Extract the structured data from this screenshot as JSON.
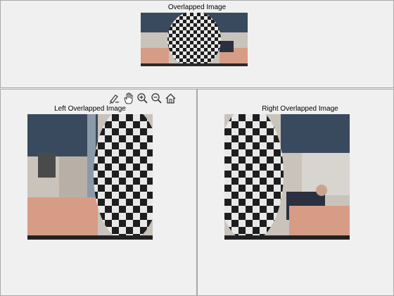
{
  "top": {
    "title": "Overlapped Image"
  },
  "left": {
    "title": "Left Overlapped Image"
  },
  "right": {
    "title": "Right Overlapped Image"
  },
  "toolbar": {
    "tools": [
      {
        "icon": "brush-icon"
      },
      {
        "icon": "pan-hand-icon"
      },
      {
        "icon": "zoom-in-icon"
      },
      {
        "icon": "zoom-out-icon"
      },
      {
        "icon": "home-icon"
      }
    ]
  },
  "colors": {
    "panel_bg": "#f0f0f0",
    "panel_border": "#a8a8a8",
    "checker_dark": "#1e1e1e",
    "checker_light": "#e8e8e8",
    "wall": "#c9c3bc",
    "ceiling": "#3a4a5e",
    "skin": "#d79c86"
  }
}
